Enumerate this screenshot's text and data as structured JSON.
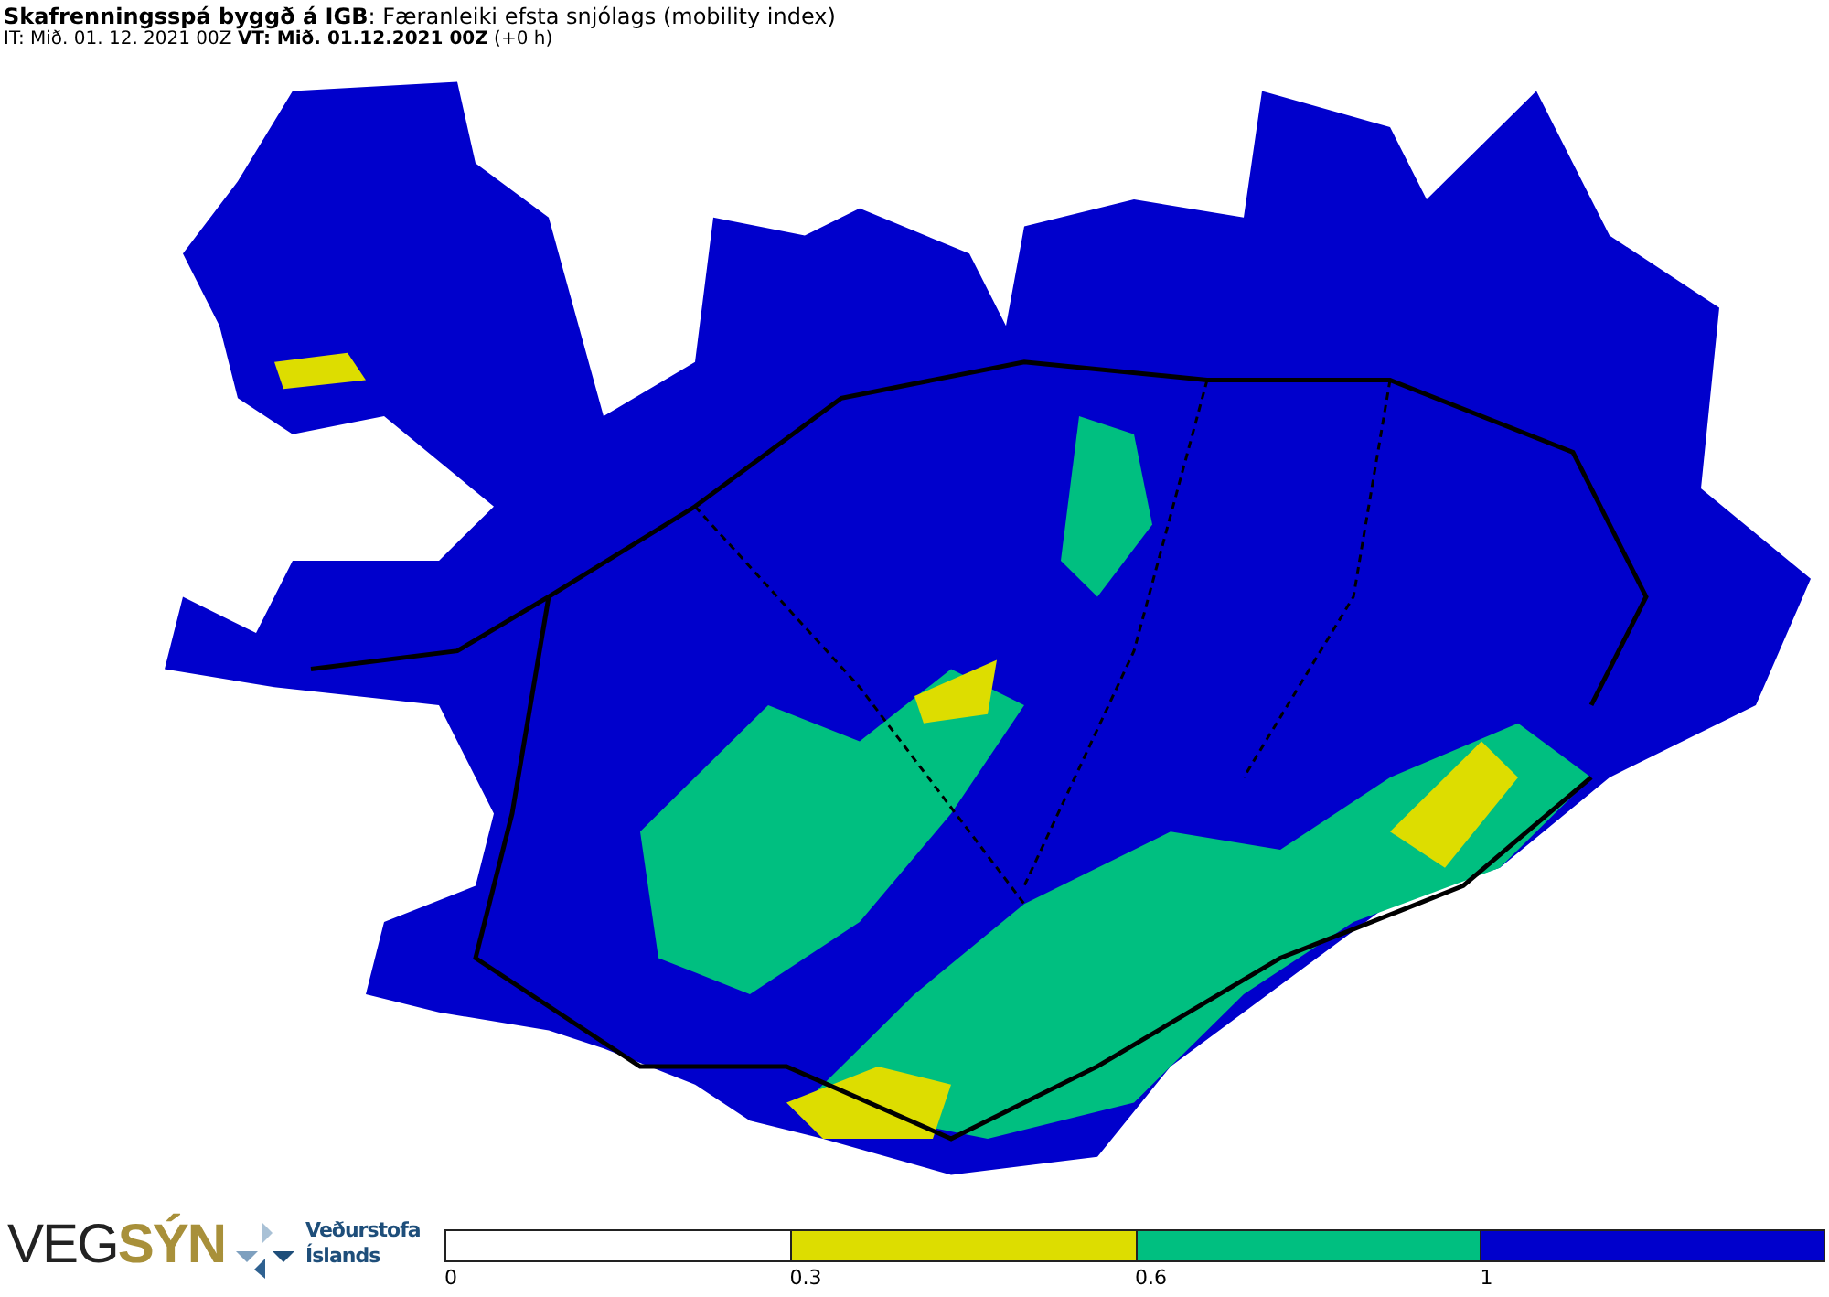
{
  "header": {
    "title": "**Skafrenningsspá byggð á IGB**: Færanleiki efsta snjólags (mobility index)",
    "subtitle": "IT: Mið. 01. 12. 2021 00Z **VT: Mið. 01.12.2021 00Z** (+0 h)"
  },
  "footer": {
    "logo": "VEG**SÝN**",
    "org_lines": [
      "Veðurstofa",
      "Íslands"
    ],
    "legend": [
      {
        "label": "0",
        "color": "#ffffff"
      },
      {
        "label": "0.3",
        "color": "#dddd00"
      },
      {
        "label": "0.6",
        "color": "#00bf80"
      },
      {
        "label": "1",
        "color": "#0000cc"
      }
    ]
  }
}
